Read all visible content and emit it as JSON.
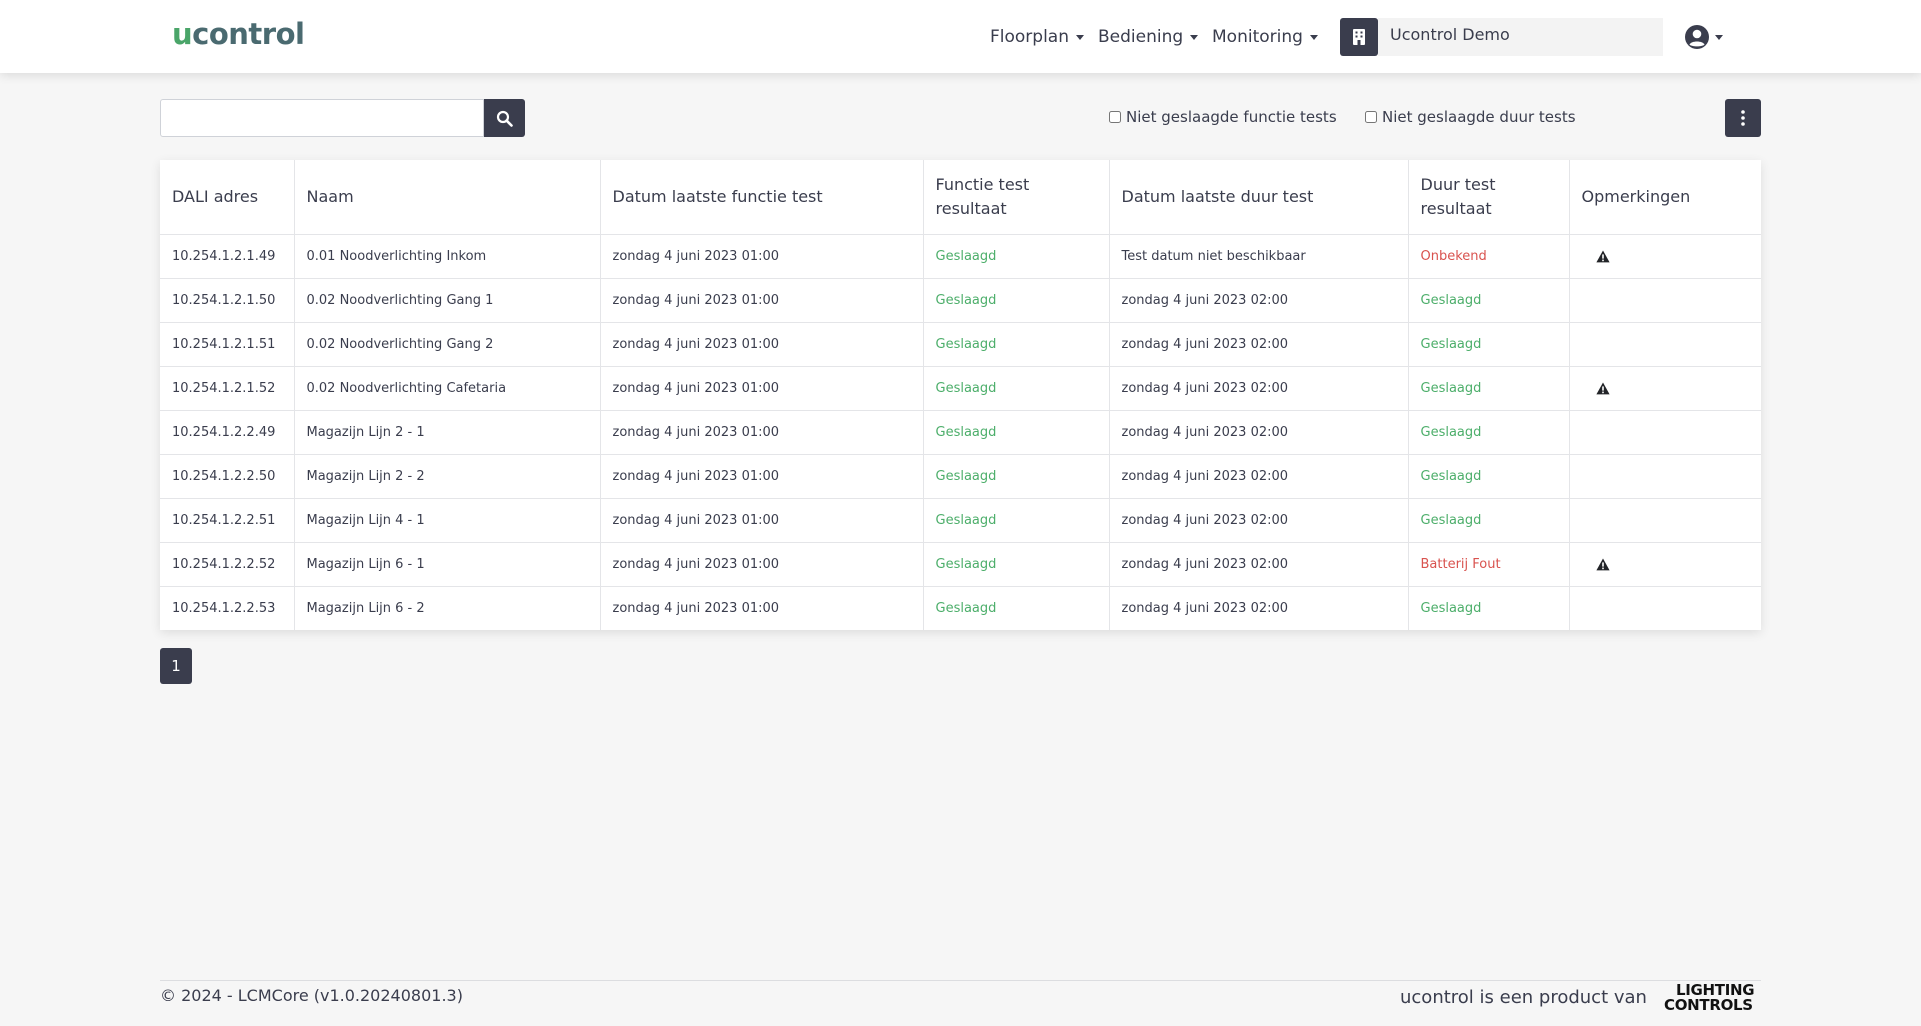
{
  "brand": {
    "logo_u": "u",
    "logo_rest": "control"
  },
  "nav": {
    "menus": [
      {
        "label": "Floorplan"
      },
      {
        "label": "Bediening"
      },
      {
        "label": "Monitoring"
      }
    ],
    "site_name": "Ucontrol Demo"
  },
  "toolbar": {
    "search_value": "",
    "filters": [
      {
        "label": "Niet geslaagde functie tests",
        "checked": false
      },
      {
        "label": "Niet geslaagde duur tests",
        "checked": false
      }
    ]
  },
  "table": {
    "columns": [
      "DALI adres",
      "Naam",
      "Datum laatste functie test",
      "Functie test resultaat",
      "Datum laatste duur test",
      "Duur test resultaat",
      "Opmerkingen"
    ],
    "rows": [
      {
        "address": "10.254.1.2.1.49",
        "name": "0.01 Noodverlichting Inkom",
        "func_date": "zondag 4 juni 2023 01:00",
        "func_result": "Geslaagd",
        "func_ok": true,
        "dur_date": "Test datum niet beschikbaar",
        "dur_result": "Onbekend",
        "dur_ok": false,
        "warning": true
      },
      {
        "address": "10.254.1.2.1.50",
        "name": "0.02 Noodverlichting Gang 1",
        "func_date": "zondag 4 juni 2023 01:00",
        "func_result": "Geslaagd",
        "func_ok": true,
        "dur_date": "zondag 4 juni 2023 02:00",
        "dur_result": "Geslaagd",
        "dur_ok": true,
        "warning": false
      },
      {
        "address": "10.254.1.2.1.51",
        "name": "0.02 Noodverlichting Gang 2",
        "func_date": "zondag 4 juni 2023 01:00",
        "func_result": "Geslaagd",
        "func_ok": true,
        "dur_date": "zondag 4 juni 2023 02:00",
        "dur_result": "Geslaagd",
        "dur_ok": true,
        "warning": false
      },
      {
        "address": "10.254.1.2.1.52",
        "name": "0.02 Noodverlichting Cafetaria",
        "func_date": "zondag 4 juni 2023 01:00",
        "func_result": "Geslaagd",
        "func_ok": true,
        "dur_date": "zondag 4 juni 2023 02:00",
        "dur_result": "Geslaagd",
        "dur_ok": true,
        "warning": true
      },
      {
        "address": "10.254.1.2.2.49",
        "name": "Magazijn Lijn 2 - 1",
        "func_date": "zondag 4 juni 2023 01:00",
        "func_result": "Geslaagd",
        "func_ok": true,
        "dur_date": "zondag 4 juni 2023 02:00",
        "dur_result": "Geslaagd",
        "dur_ok": true,
        "warning": false
      },
      {
        "address": "10.254.1.2.2.50",
        "name": "Magazijn Lijn 2 - 2",
        "func_date": "zondag 4 juni 2023 01:00",
        "func_result": "Geslaagd",
        "func_ok": true,
        "dur_date": "zondag 4 juni 2023 02:00",
        "dur_result": "Geslaagd",
        "dur_ok": true,
        "warning": false
      },
      {
        "address": "10.254.1.2.2.51",
        "name": "Magazijn Lijn 4 - 1",
        "func_date": "zondag 4 juni 2023 01:00",
        "func_result": "Geslaagd",
        "func_ok": true,
        "dur_date": "zondag 4 juni 2023 02:00",
        "dur_result": "Geslaagd",
        "dur_ok": true,
        "warning": false
      },
      {
        "address": "10.254.1.2.2.52",
        "name": "Magazijn Lijn 6 - 1",
        "func_date": "zondag 4 juni 2023 01:00",
        "func_result": "Geslaagd",
        "func_ok": true,
        "dur_date": "zondag 4 juni 2023 02:00",
        "dur_result": "Batterij Fout",
        "dur_ok": false,
        "warning": true
      },
      {
        "address": "10.254.1.2.2.53",
        "name": "Magazijn Lijn 6 - 2",
        "func_date": "zondag 4 juni 2023 01:00",
        "func_result": "Geslaagd",
        "func_ok": true,
        "dur_date": "zondag 4 juni 2023 02:00",
        "dur_result": "Geslaagd",
        "dur_ok": true,
        "warning": false
      }
    ]
  },
  "pagination": {
    "current_page": "1"
  },
  "footer": {
    "copyright": "© 2024 - LCMCore (v1.0.20240801.3)",
    "product_of": "ucontrol is een product van",
    "partner_logo_line1": "LIGHTING",
    "partner_logo_line2": "CONTROLS"
  },
  "colors": {
    "primary_dark": "#3a3d4d",
    "success": "#4cae6a",
    "danger": "#d9534f",
    "brand_green": "#4aa569",
    "brand_teal": "#4a6a70"
  },
  "icons": {
    "search_button": "search-icon",
    "more_button": "kebab-vertical-icon",
    "site_button": "building-icon",
    "user_menu": "user-circle-icon",
    "remark": "warning-triangle-icon"
  }
}
